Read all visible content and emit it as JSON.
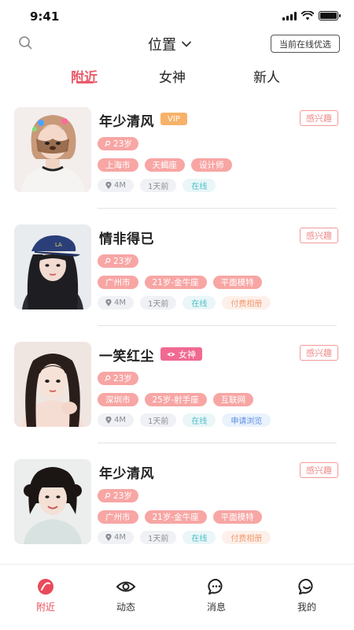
{
  "status_bar": {
    "time": "9:41"
  },
  "header": {
    "location_label": "位置",
    "online_button": "当前在线优选"
  },
  "tabs": [
    {
      "label": "附近",
      "active": true
    },
    {
      "label": "女神",
      "active": false
    },
    {
      "label": "新人",
      "active": false
    }
  ],
  "users": [
    {
      "name": "年少清风",
      "badge": "VIP",
      "interest": "感兴趣",
      "age": "23岁",
      "tags": [
        "上海市",
        "天蝎座",
        "设计师"
      ],
      "distance": "4M",
      "last_active": "1天前",
      "online": "在线",
      "extra": ""
    },
    {
      "name": "情非得已",
      "badge": "",
      "interest": "感兴趣",
      "age": "23岁",
      "tags": [
        "广州市",
        "21岁-金牛座",
        "平面模特"
      ],
      "distance": "4M",
      "last_active": "1天前",
      "online": "在线",
      "extra": "付费相册"
    },
    {
      "name": "一笑红尘",
      "badge": "女神",
      "interest": "感兴趣",
      "age": "23岁",
      "tags": [
        "深圳市",
        "25岁-射手座",
        "互联网"
      ],
      "distance": "4M",
      "last_active": "1天前",
      "online": "在线",
      "extra": "申请浏览"
    },
    {
      "name": "年少清风",
      "badge": "",
      "interest": "感兴趣",
      "age": "23岁",
      "tags": [
        "广州市",
        "21岁-金牛座",
        "平面模特"
      ],
      "distance": "4M",
      "last_active": "1天前",
      "online": "在线",
      "extra": "付费相册"
    }
  ],
  "bottom_nav": [
    {
      "label": "附近",
      "icon": "nearby-icon",
      "active": true
    },
    {
      "label": "动态",
      "icon": "eye-icon",
      "active": false
    },
    {
      "label": "消息",
      "icon": "chat-icon",
      "active": false
    },
    {
      "label": "我的",
      "icon": "profile-icon",
      "active": false
    }
  ],
  "colors": {
    "accent": "#ea5b6a",
    "tag_pink": "#f7a6a4",
    "vip": "#f7b26a",
    "goddess": "#f06a92"
  }
}
